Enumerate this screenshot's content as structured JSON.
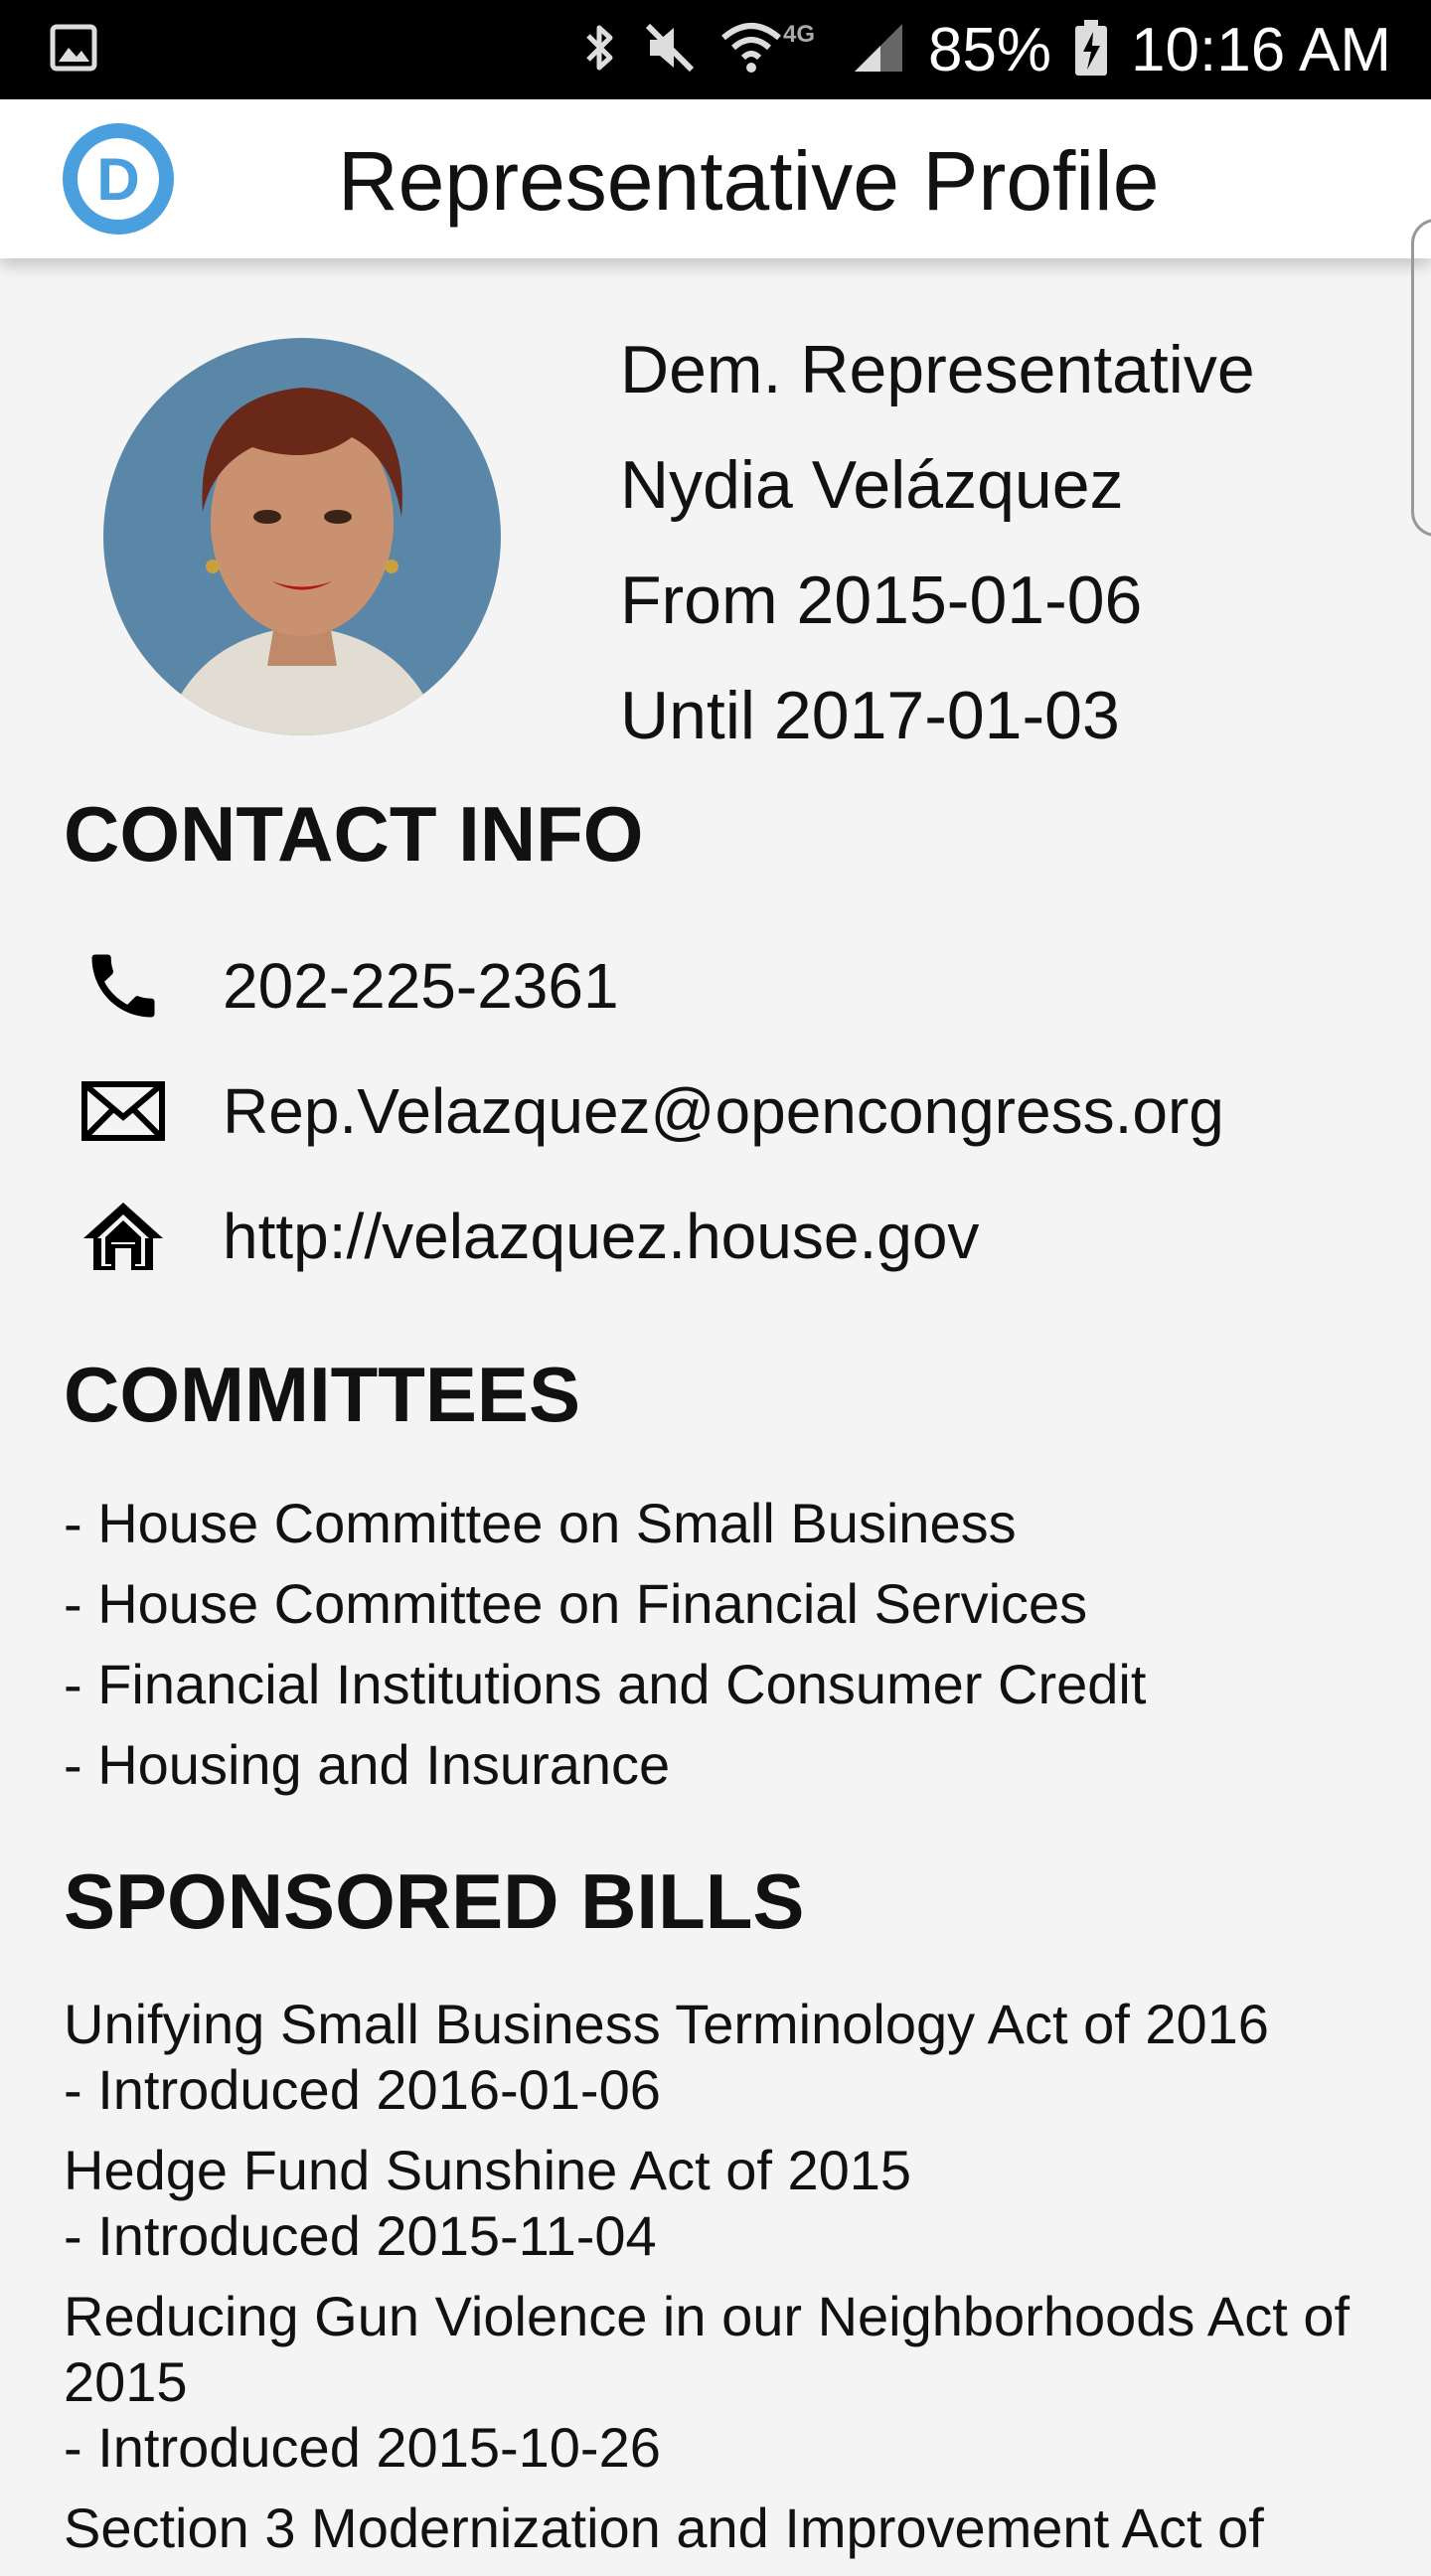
{
  "status_bar": {
    "battery": "85%",
    "time": "10:16 AM",
    "network": "4G"
  },
  "app_bar": {
    "title": "Representative Profile",
    "logo_letter": "D"
  },
  "profile": {
    "lines": [
      "Dem. Representative",
      "Nydia Velázquez",
      "From  2015-01-06",
      "Until  2017-01-03"
    ]
  },
  "contact": {
    "title": "CONTACT INFO",
    "phone": "202-225-2361",
    "email": "Rep.Velazquez@opencongress.org",
    "website": "http://velazquez.house.gov"
  },
  "committees": {
    "title": "COMMITTEES",
    "items": [
      "- House Committee on Small Business",
      "- House Committee on Financial Services",
      "- Financial Institutions and Consumer Credit",
      "- Housing and Insurance"
    ]
  },
  "bills": {
    "title": "SPONSORED BILLS",
    "items": [
      {
        "name": "Unifying Small Business Terminology Act of 2016",
        "introduced": "- Introduced 2016-01-06"
      },
      {
        "name": "Hedge Fund Sunshine Act of 2015",
        "introduced": "- Introduced 2015-11-04"
      },
      {
        "name": "Reducing Gun Violence in our Neighborhoods Act of 2015",
        "introduced": "- Introduced 2015-10-26"
      },
      {
        "name": "Section 3 Modernization and Improvement Act of",
        "introduced": ""
      }
    ]
  },
  "colors": {
    "logo_blue": "#4a9fdf",
    "background": "#f4f4f4"
  }
}
